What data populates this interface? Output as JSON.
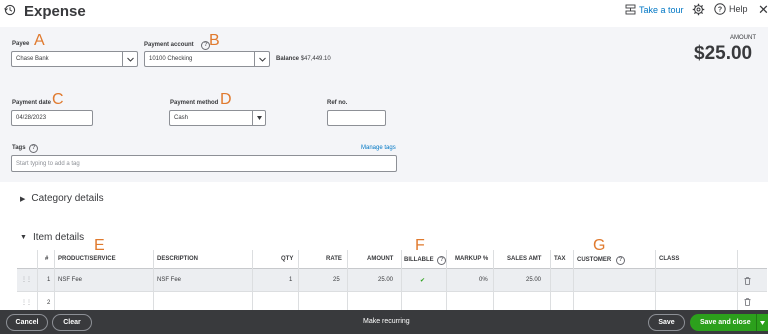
{
  "header": {
    "title": "Expense",
    "take_tour": "Take a tour",
    "help": "Help",
    "close": "✕"
  },
  "amount": {
    "label": "AMOUNT",
    "value": "$25.00"
  },
  "payee": {
    "label": "Payee",
    "value": "Chase Bank"
  },
  "payment_account": {
    "label": "Payment account",
    "value": "10100 Checking",
    "balance_label": "Balance",
    "balance_value": "$47,449.10"
  },
  "payment_date": {
    "label": "Payment date",
    "value": "04/28/2023"
  },
  "payment_method": {
    "label": "Payment method",
    "value": "Cash"
  },
  "ref_no": {
    "label": "Ref no.",
    "value": ""
  },
  "tags": {
    "label": "Tags",
    "placeholder": "Start typing to add a tag",
    "manage": "Manage tags"
  },
  "annotations": {
    "a": "A",
    "b": "B",
    "c": "C",
    "d": "D",
    "e": "E",
    "f": "F",
    "g": "G"
  },
  "sections": {
    "category": "Category details",
    "items": "Item details"
  },
  "item_table": {
    "headers": [
      "#",
      "PRODUCT/SERVICE",
      "DESCRIPTION",
      "QTY",
      "RATE",
      "AMOUNT",
      "BILLABLE",
      "MARKUP %",
      "SALES AMT",
      "TAX",
      "CUSTOMER",
      "CLASS"
    ],
    "rows": [
      {
        "num": "1",
        "product": "NSF Fee",
        "description": "NSF Fee",
        "qty": "1",
        "rate": "25",
        "amount": "25.00",
        "billable": "✔",
        "markup": "0%",
        "sales_amt": "25.00",
        "tax": "",
        "customer": "",
        "class": ""
      },
      {
        "num": "2",
        "product": "",
        "description": "",
        "qty": "",
        "rate": "",
        "amount": "",
        "billable": "",
        "markup": "",
        "sales_amt": "",
        "tax": "",
        "customer": "",
        "class": ""
      }
    ]
  },
  "footer": {
    "cancel": "Cancel",
    "clear": "Clear",
    "make_recurring": "Make recurring",
    "save": "Save",
    "save_and_close": "Save and close"
  },
  "colors": {
    "accent": "#0077c5",
    "annotation": "#e07a2e",
    "save_green": "#2ca01c",
    "footer_bg": "#393a3d"
  }
}
